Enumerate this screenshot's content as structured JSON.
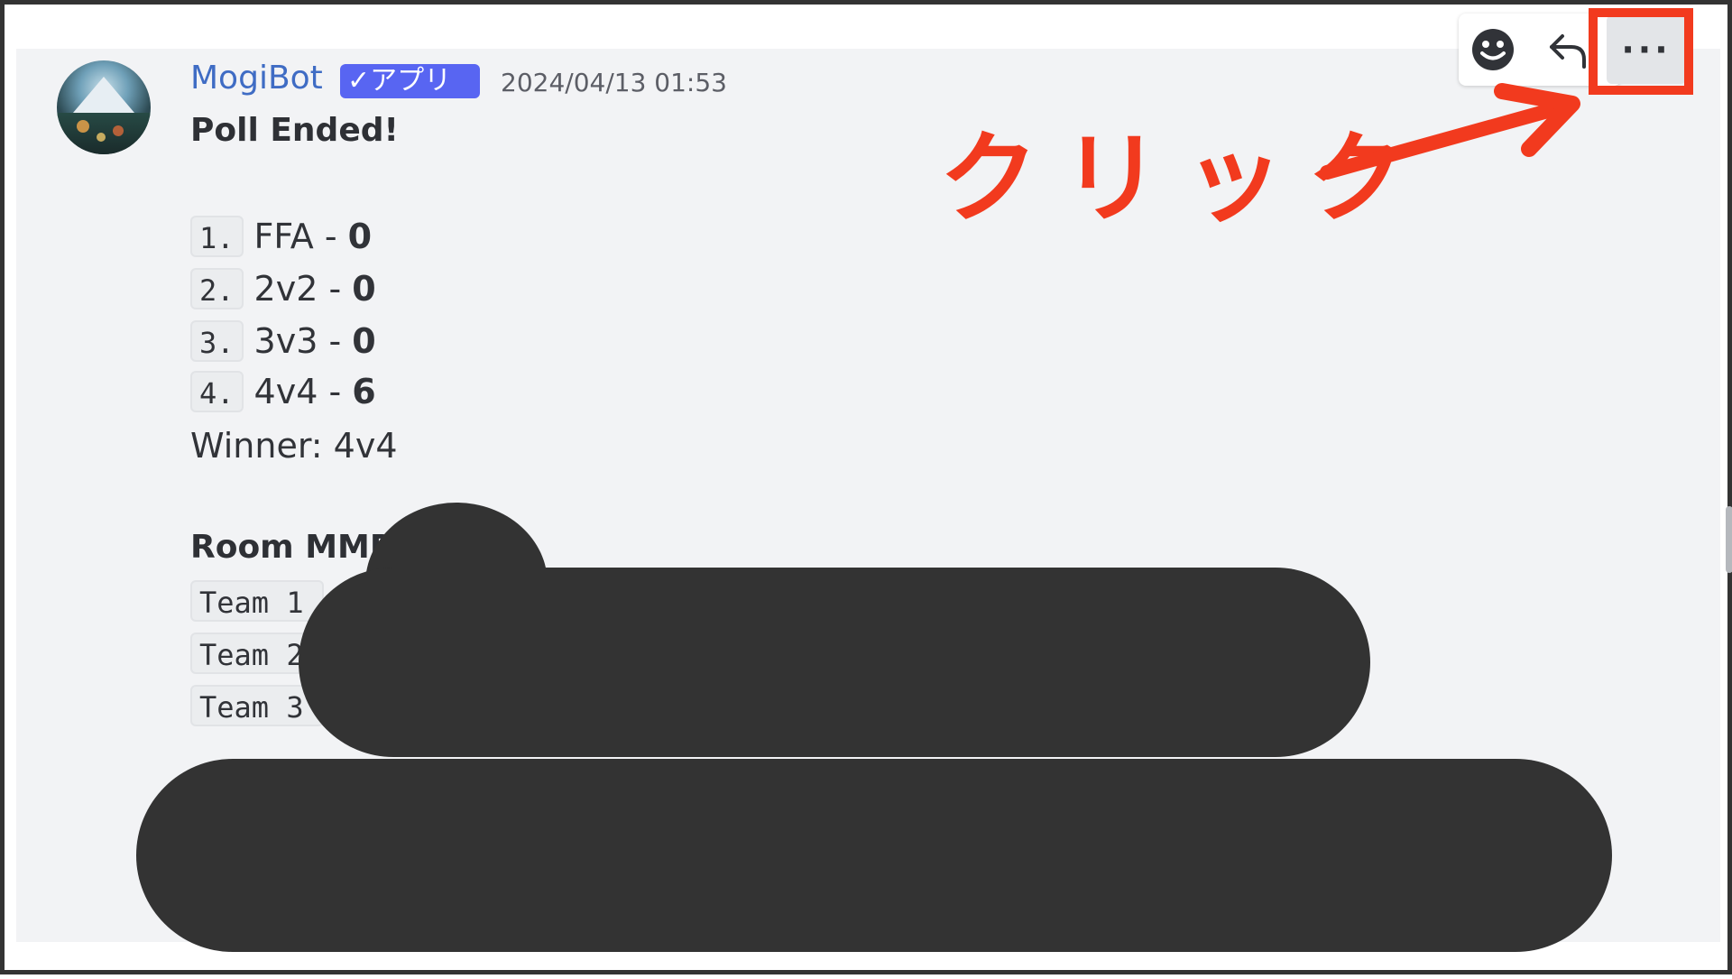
{
  "message": {
    "username": "MogiBot",
    "badge_label": "✓アプリ",
    "timestamp": "2024/04/13 01:53",
    "poll_title": "Poll Ended!",
    "poll_options": [
      {
        "number": "1.",
        "label": "FFA - ",
        "votes": "0"
      },
      {
        "number": "2.",
        "label": "2v2 - ",
        "votes": "0"
      },
      {
        "number": "3.",
        "label": "3v3 - ",
        "votes": "0"
      },
      {
        "number": "4.",
        "label": "4v4 - ",
        "votes": "6"
      }
    ],
    "winner": "Winner: 4v4",
    "room_mmr_title": "Room MMR",
    "teams": [
      {
        "label": "Team 1"
      },
      {
        "label": "Team 2"
      },
      {
        "label": "Team 3"
      }
    ]
  },
  "toolbar": {
    "reaction_icon": "emoji-icon",
    "reply_icon": "reply-icon",
    "more_label": "···"
  },
  "annotation": {
    "text": "クリック",
    "color": "#f23a1e"
  },
  "colors": {
    "username": "#3f6cc4",
    "badge": "#5865f2",
    "redaction": "#333333",
    "message_bg": "#f2f3f5"
  }
}
